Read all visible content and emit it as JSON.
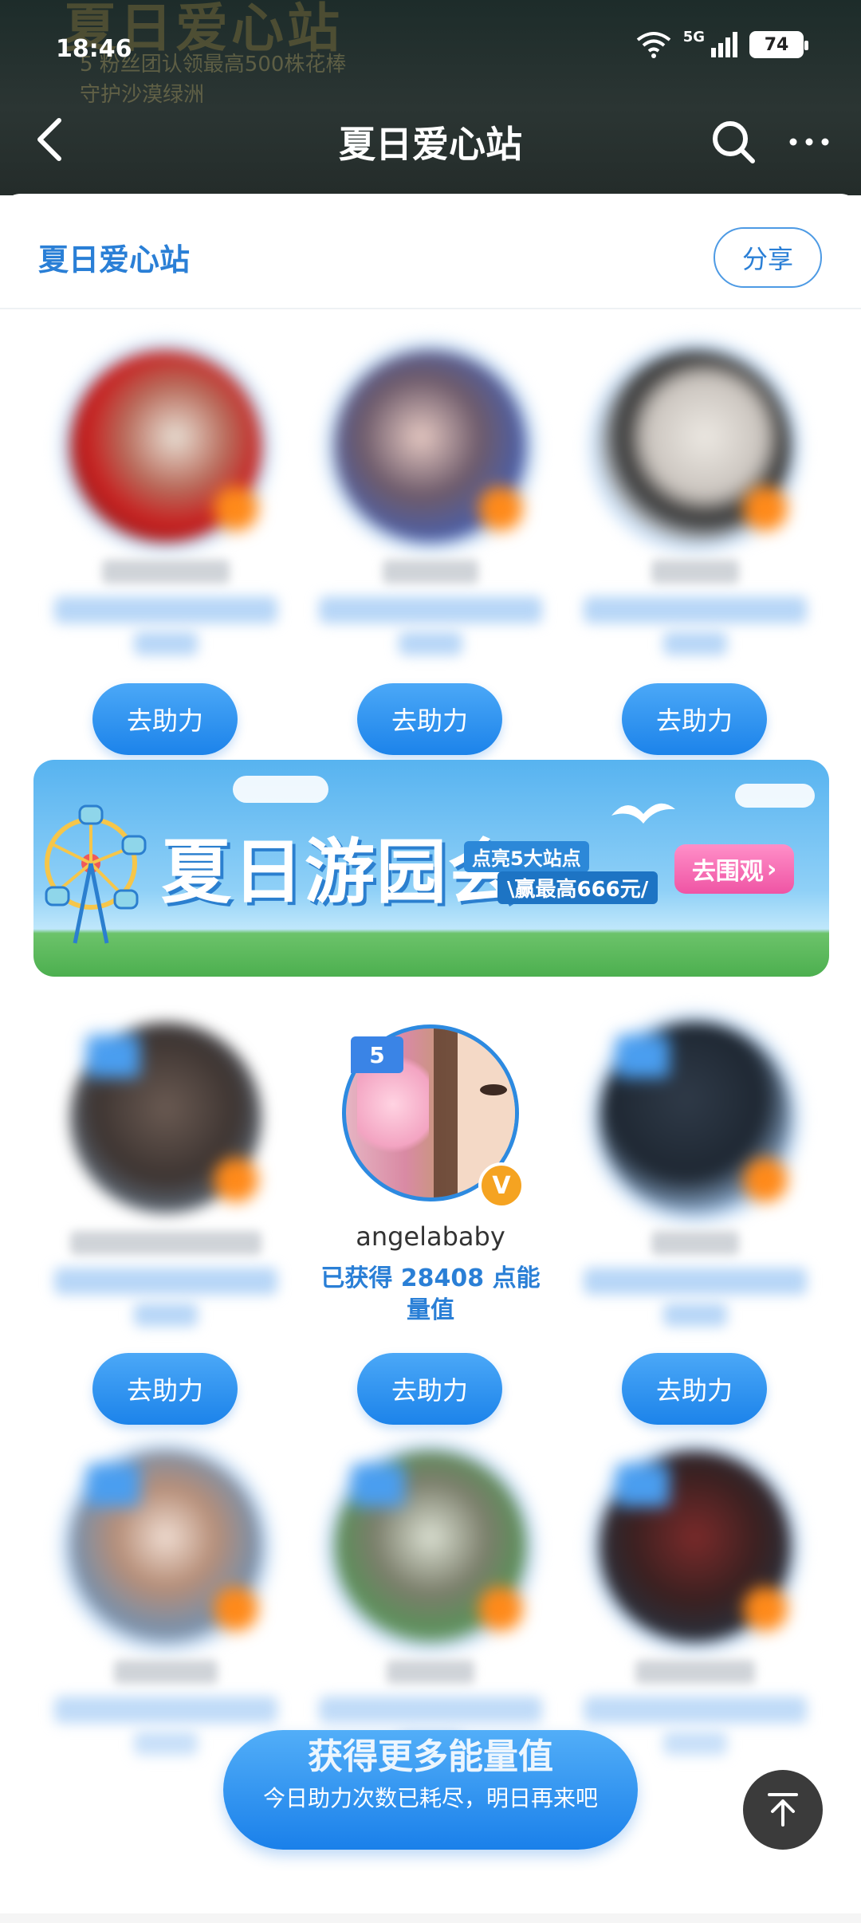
{
  "status_bar": {
    "time": "18:46",
    "network": "5G",
    "battery": "74"
  },
  "header_bg": {
    "line1": "夏日爱心站",
    "line2": "5 粉丝团认领最高500株花棒",
    "line3": "守护沙漠绿洲"
  },
  "nav": {
    "title": "夏日爱心站",
    "back_icon": "back-arrow-icon",
    "search_icon": "search-icon",
    "more_icon": "more-icon"
  },
  "panel": {
    "title": "夏日爱心站",
    "share_label": "分享"
  },
  "help_label": "去助力",
  "banner": {
    "title": "夏日游园会",
    "subtitle_1": "点亮5大站点",
    "subtitle_2": "\\赢最高666元/",
    "cta": "去围观"
  },
  "featured": {
    "rank": "5",
    "name": "angelababy",
    "score_text": "已获得 28408 点能量值",
    "verified_badge": "V"
  },
  "bottom": {
    "energy_title": "获得更多能量值",
    "energy_sub": "今日助力次数已耗尽，明日再来吧"
  },
  "colors": {
    "accent": "#2a7fd6",
    "button": "#1c83ea",
    "badge": "#ff8a1a"
  }
}
